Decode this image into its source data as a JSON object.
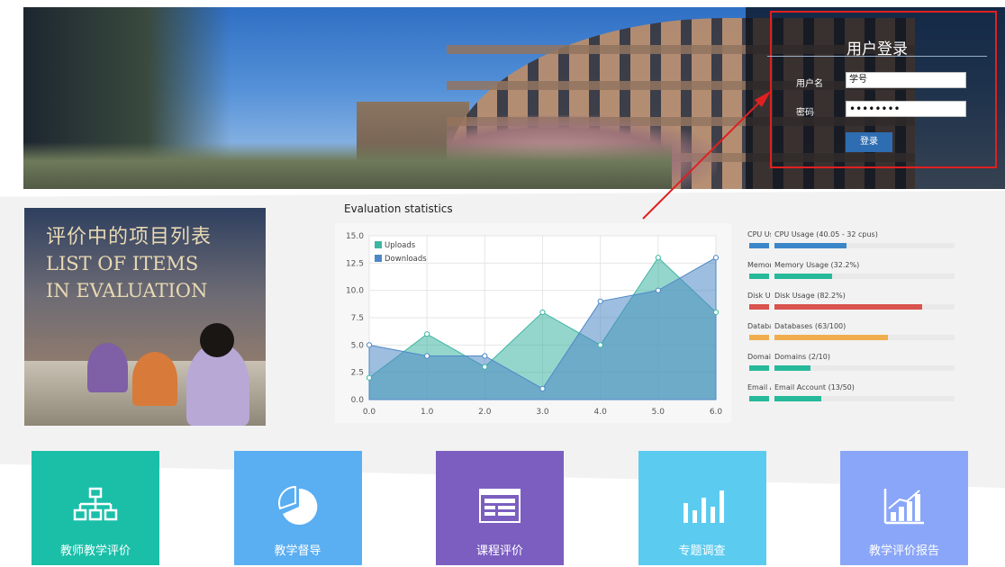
{
  "login": {
    "title": "用户登录",
    "username_label": "用户名",
    "username_value": "学号",
    "password_label": "密码",
    "password_value": "••••••••",
    "submit_label": "登录"
  },
  "poster": {
    "title_cn": "评价中的项目列表",
    "title_en_1": "LIST OF ITEMS",
    "title_en_2": "IN EVALUATION"
  },
  "chart_data": {
    "type": "area",
    "title": "Evaluation statistics",
    "x": [
      0,
      1,
      2,
      3,
      4,
      5,
      6
    ],
    "x_tick_labels": [
      "0.0",
      "1.0",
      "2.0",
      "3.0",
      "4.0",
      "5.0",
      "6.0"
    ],
    "y_tick_labels": [
      "0.0",
      "2.5",
      "5.0",
      "7.5",
      "10.0",
      "12.5",
      "15.0"
    ],
    "xlim": [
      0,
      6
    ],
    "ylim": [
      0,
      15
    ],
    "grid": true,
    "legend_position": "top-left",
    "series": [
      {
        "name": "Uploads",
        "color": "#3db5a3",
        "values": [
          2,
          6,
          3,
          8,
          5,
          13,
          8
        ]
      },
      {
        "name": "Downloads",
        "color": "#4e88c6",
        "values": [
          5,
          4,
          4,
          1,
          9,
          10,
          13
        ]
      }
    ]
  },
  "stats": [
    {
      "short": "CPU Usage (40.05 - 32 cpus)",
      "label": "CPU Usage (40.05 - 32 cpus)",
      "percent": 40,
      "color": "#3a86c8"
    },
    {
      "short": "Memory Usage (32.2%)",
      "label": "Memory Usage (32.2%)",
      "percent": 32.2,
      "color": "#26b99a"
    },
    {
      "short": "Disk Usage (82.2%)",
      "label": "Disk Usage (82.2%)",
      "percent": 82.2,
      "color": "#d9534f"
    },
    {
      "short": "Databases (63/100)",
      "label": "Databases (63/100)",
      "percent": 63,
      "color": "#f0ad4e"
    },
    {
      "short": "Domains (2/10)",
      "label": "Domains (2/10)",
      "percent": 20,
      "color": "#26b99a"
    },
    {
      "short": "Email Account (13/50)",
      "label": "Email Account (13/50)",
      "percent": 26,
      "color": "#26b99a"
    }
  ],
  "tiles": [
    {
      "label": "教师教学评价",
      "icon": "org-chart-icon",
      "color": "#1bbfa8"
    },
    {
      "label": "教学督导",
      "icon": "pie-chart-icon",
      "color": "#5aaef2"
    },
    {
      "label": "课程评价",
      "icon": "window-table-icon",
      "color": "#7b5ec0"
    },
    {
      "label": "专题调查",
      "icon": "bar-chart-icon",
      "color": "#5ccbf0"
    },
    {
      "label": "教学评价报告",
      "icon": "growth-chart-icon",
      "color": "#8aa6f8"
    }
  ]
}
